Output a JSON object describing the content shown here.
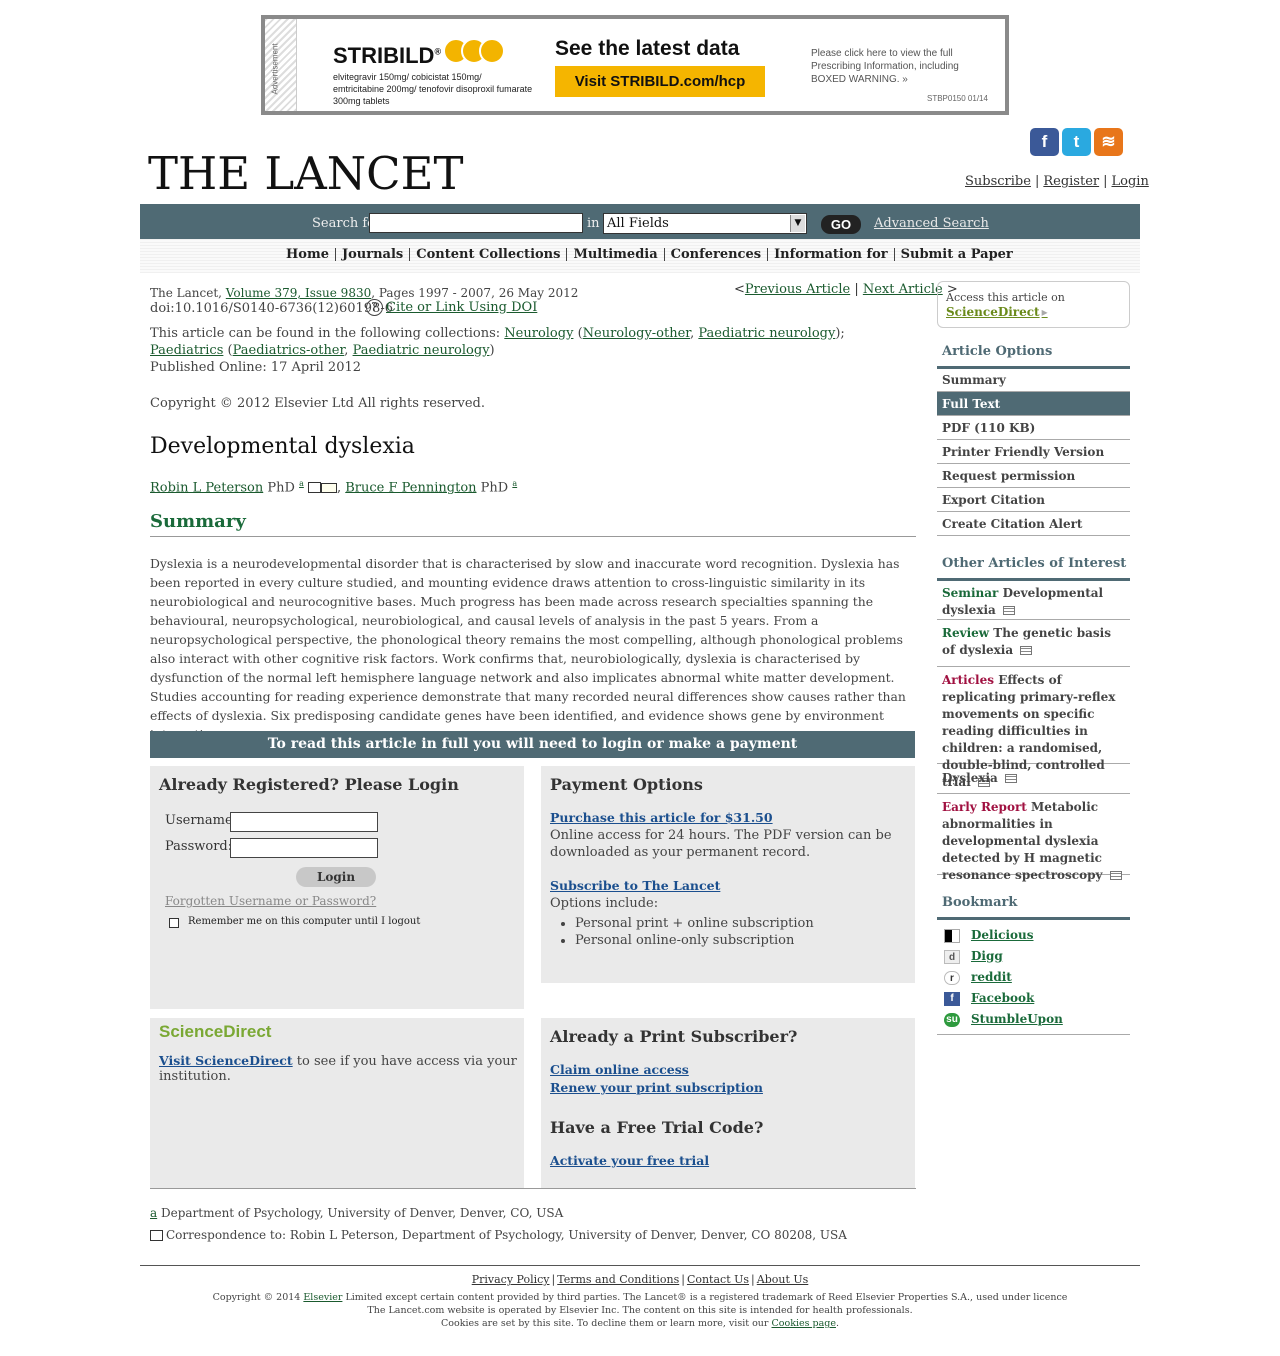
{
  "ad": {
    "label": "Advertisement",
    "brand": "STRIBILD",
    "brand_mark": "®",
    "description": "elvitegravir 150mg/ cobicistat 150mg/ emtricitabine 200mg/ tenofovir disoproxil fumarate 300mg tablets",
    "headline": "See the latest data",
    "cta": "Visit STRIBILD.com/hcp",
    "pi_text": "Please click here to view the full Prescribing Information, including BOXED WARNING. »",
    "code": "STBP0150  01/14",
    "accent_color": "#f5b500"
  },
  "header": {
    "logo": "THE LANCET",
    "social": [
      {
        "icon": "facebook-icon",
        "glyph": "f",
        "color": "#3b5998"
      },
      {
        "icon": "twitter-icon",
        "glyph": "t",
        "color": "#2aa9e0"
      },
      {
        "icon": "rss-icon",
        "glyph": "≋",
        "color": "#e8761a"
      }
    ],
    "links": [
      "Subscribe",
      "Register",
      "Login"
    ]
  },
  "search": {
    "label": "Search for",
    "in_label": "in",
    "query_value": "",
    "field_selected": "All Fields",
    "go": "GO",
    "advanced": "Advanced Search"
  },
  "nav": [
    "Home",
    "Journals",
    "Content Collections",
    "Multimedia",
    "Conferences",
    "Information for",
    "Submit a Paper"
  ],
  "article": {
    "journal": "The Lancet,",
    "volume_link": "Volume 379, Issue 9830",
    "pages": ", Pages  1997 - 2007, 26 May 2012",
    "prev": "Previous Article",
    "next": "Next Article",
    "doi": "doi:10.1016/S0140-6736(12)60198-6",
    "cite_link": "Cite or Link Using DOI",
    "collections_intro": "This article can be found in the following collections:",
    "collections": {
      "c1": "Neurology",
      "c2": "Neurology-other",
      "c3": "Paediatric neurology",
      "c4": "Paediatrics",
      "c5": "Paediatrics-other",
      "c6": "Paediatric neurology"
    },
    "published": "Published Online: 17 April 2012",
    "copyright": "Copyright © 2012 Elsevier Ltd All rights reserved.",
    "title": "Developmental dyslexia",
    "author1": "Robin L Peterson",
    "author1_deg": "PhD",
    "author2": "Bruce F Pennington",
    "author2_deg": "PhD",
    "aff_sup": "a",
    "summary_heading": "Summary",
    "abstract": "Dyslexia is a neurodevelopmental disorder that is characterised by slow and inaccurate word recognition. Dyslexia has been reported in every culture studied, and mounting evidence draws attention to cross-linguistic similarity in its neurobiological and neurocognitive bases. Much progress has been made across research specialties spanning the behavioural, neuropsychological, neurobiological, and causal levels of analysis in the past 5 years. From a neuropsychological perspective, the phonological theory remains the most compelling, although phonological problems also interact with other cognitive risk factors. Work confirms that, neurobiologically, dyslexia is characterised by dysfunction of the normal left hemisphere language network and also implicates abnormal white matter development. Studies accounting for reading experience demonstrate that many recorded neural differences show causes rather than effects of dyslexia. Six predisposing candidate genes have been identified, and evidence shows gene by environment interaction."
  },
  "paywall": {
    "banner": "To read this article in full you will need to login or make a payment",
    "login": {
      "heading": "Already Registered?  Please Login",
      "username_label": "Username:",
      "password_label": "Password:",
      "username_value": "",
      "password_value": "",
      "button": "Login",
      "forgot": "Forgotten Username or Password?",
      "remember": "Remember me on this computer until I logout"
    },
    "payment": {
      "heading": "Payment Options",
      "purchase": "Purchase this article for $31.50",
      "purchase_desc": "Online access for 24 hours. The PDF version can be downloaded as your permanent record.",
      "subscribe": "Subscribe to The Lancet",
      "options_intro": "Options include:",
      "options": [
        "Personal print + online subscription",
        "Personal online-only subscription"
      ]
    },
    "sciencedirect": {
      "logo": "ScienceDirect",
      "link": "Visit ScienceDirect",
      "rest": " to see if you have access via your institution."
    },
    "print": {
      "heading": "Already a Print Subscriber?",
      "claim": "Claim online access",
      "renew": "Renew your print subscription",
      "trial_heading": "Have a Free Trial Code?",
      "trial": "Activate your free trial"
    }
  },
  "affiliations": {
    "a_label": "a",
    "a_text": " Department of Psychology, University of Denver, Denver, CO, USA",
    "corr": "Correspondence to: Robin L Peterson, Department of Psychology, University of Denver, Denver, CO 80208, USA"
  },
  "sidebar": {
    "access_text": "Access this article on",
    "access_link": "ScienceDirect",
    "options_heading": "Article Options",
    "options": [
      "Summary",
      "Full Text",
      "PDF (110 KB)",
      "Printer Friendly Version",
      "Request permission",
      "Export Citation",
      "Create Citation Alert"
    ],
    "active_option": "Full Text",
    "other_heading": "Other Articles of Interest",
    "other": [
      {
        "type": "Seminar",
        "title": "Developmental dyslexia"
      },
      {
        "type": "Review",
        "title": "The genetic basis of dyslexia"
      },
      {
        "type": "Articles",
        "title": "Effects of replicating primary-reflex movements on specific reading difficulties in children: a randomised, double-blind, controlled trial"
      },
      {
        "type": "",
        "title": "Dyslexia"
      },
      {
        "type": "Early Report",
        "title": "Metabolic abnormalities in developmental dyslexia detected by H magnetic resonance spectroscopy"
      }
    ],
    "bookmark_heading": "Bookmark",
    "bookmarks": [
      "Delicious",
      "Digg",
      "reddit",
      "Facebook",
      "StumbleUpon"
    ]
  },
  "footer": {
    "links": [
      "Privacy Policy",
      "Terms and Conditions",
      "Contact Us",
      "About Us"
    ],
    "line1_pre": "Copyright © 2014 ",
    "line1_link": "Elsevier",
    "line1_post": " Limited except certain content provided by third parties. The Lancet® is a registered trademark of Reed Elsevier Properties S.A., used under licence",
    "line2": "The Lancet.com website is operated by Elsevier Inc. The content on this site is intended for health professionals.",
    "line3_pre": "Cookies are set by this site. To decline them or learn more, visit our ",
    "line3_link": "Cookies page",
    "line3_post": "."
  }
}
